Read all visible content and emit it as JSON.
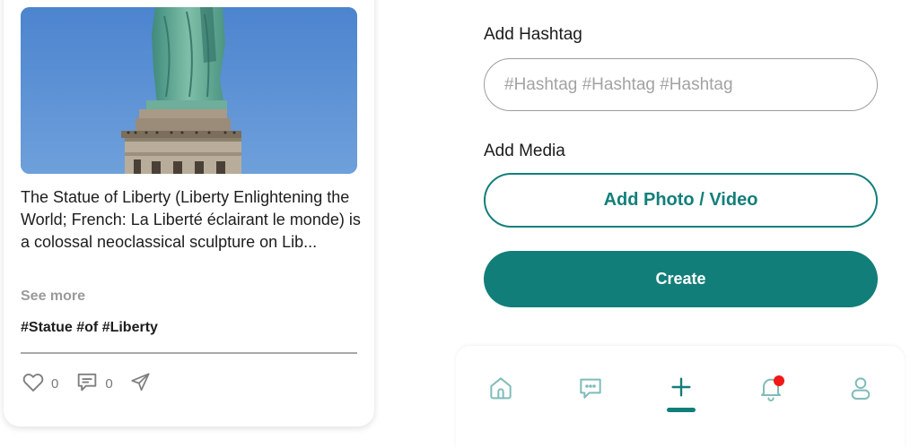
{
  "post": {
    "body": "The Statue of Liberty (Liberty Enlightening the World; French: La Liberté éclairant le monde) is a colossal neoclassical sculpture on Lib...",
    "see_more": "See more",
    "hashtags": "#Statue #of #Liberty",
    "likes": "0",
    "comments": "0",
    "icons": {
      "like": "heart-icon",
      "comment": "comment-icon",
      "share": "send-icon"
    }
  },
  "form": {
    "hashtag_label": "Add Hashtag",
    "hashtag_placeholder": "#Hashtag #Hashtag #Hashtag",
    "hashtag_value": "",
    "media_label": "Add Media",
    "add_media_button": "Add Photo / Video",
    "create_button": "Create"
  },
  "bottom_nav": {
    "items": [
      {
        "name": "home",
        "icon": "home-icon"
      },
      {
        "name": "messages",
        "icon": "chat-icon"
      },
      {
        "name": "create",
        "icon": "plus-icon",
        "active": true
      },
      {
        "name": "notifications",
        "icon": "bell-icon",
        "badge": true
      },
      {
        "name": "profile",
        "icon": "user-icon"
      }
    ]
  },
  "colors": {
    "accent": "#127e79",
    "icon": "#7fbcb8",
    "notification_dot": "#f01818",
    "sky": "#5b90d6"
  }
}
